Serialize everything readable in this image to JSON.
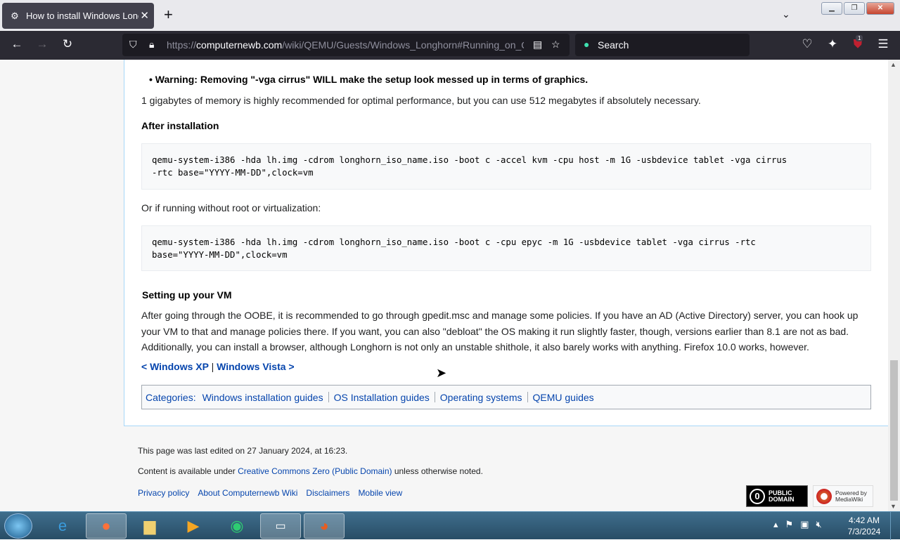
{
  "browser": {
    "tab_title": "How to install Windows Longhorn",
    "tab_close": "✕",
    "new_tab": "+",
    "url_domain": "computernewb.com",
    "url_prefix": "https://",
    "url_path": "/wiki/QEMU/Guests/Windows_Longhorn#Running_on_Q",
    "search_placeholder": "Search",
    "extension_badge": "1"
  },
  "article": {
    "warning": "Warning: Removing \"-vga cirrus\" WILL make the setup look messed up in terms of graphics.",
    "memory_note": "1 gigabytes of memory is highly recommended for optimal performance, but you can use 512 megabytes if absolutely necessary.",
    "after_install_heading": "After installation",
    "cmd_kvm": "qemu-system-i386 -hda lh.img -cdrom longhorn_iso_name.iso -boot c -accel kvm -cpu host -m 1G -usbdevice tablet -vga cirrus\n-rtc base=\"YYYY-MM-DD\",clock=vm",
    "no_root_note": "Or if running without root or virtualization:",
    "cmd_noroot": "qemu-system-i386 -hda lh.img -cdrom longhorn_iso_name.iso -boot c -cpu epyc -m 1G -usbdevice tablet -vga cirrus -rtc\nbase=\"YYYY-MM-DD\",clock=vm",
    "setup_heading": "Setting up your VM",
    "setup_text": "After going through the OOBE, it is recommended to go through gpedit.msc and manage some policies. If you have an AD (Active Directory) server, you can hook up your VM to that and manage policies there. If you want, you can also \"debloat\" the OS making it run slightly faster, though, versions earlier than 8.1 are not as bad. Additionally, you can install a browser, although Longhorn is not only an unstable shithole, it also barely works with anything. Firefox 10.0 works, however.",
    "prev_link": "< Windows XP",
    "separator": "|",
    "next_link": "Windows Vista >"
  },
  "categories": {
    "label": "Categories:",
    "items": [
      "Windows installation guides",
      "OS Installation guides",
      "Operating systems",
      "QEMU guides"
    ]
  },
  "footer": {
    "last_edited": "This page was last edited on 27 January 2024, at 16:23.",
    "license_prefix": "Content is available under ",
    "license_link": "Creative Commons Zero (Public Domain)",
    "license_suffix": " unless otherwise noted.",
    "links": [
      "Privacy policy",
      "About Computernewb Wiki",
      "Disclaimers",
      "Mobile view"
    ],
    "pd_logo_text": "PUBLIC DOMAIN",
    "mw_logo_line1": "Powered by",
    "mw_logo_line2": "MediaWiki"
  },
  "taskbar": {
    "time": "4:42 AM",
    "date": "7/3/2024"
  }
}
